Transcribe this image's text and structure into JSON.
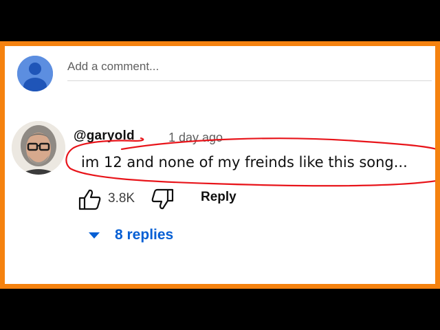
{
  "add_comment": {
    "placeholder": "Add a comment..."
  },
  "comment": {
    "username": "@garyold",
    "timestamp": "1 day ago",
    "text": "im 12 and none of my freinds like this song...",
    "like_count": "3.8K",
    "reply_label": "Reply",
    "replies_label": "8 replies"
  },
  "icons": {
    "my_avatar": "default-user-avatar-icon",
    "like": "thumbs-up-icon",
    "dislike": "thumbs-down-icon",
    "replies_toggle": "caret-down-icon"
  },
  "colors": {
    "frame_border": "#f5820f",
    "letterbox": "#000000",
    "avatar_blue": "#5c8ee0",
    "link_blue": "#065fd4",
    "annotation_red": "#e8141a"
  }
}
